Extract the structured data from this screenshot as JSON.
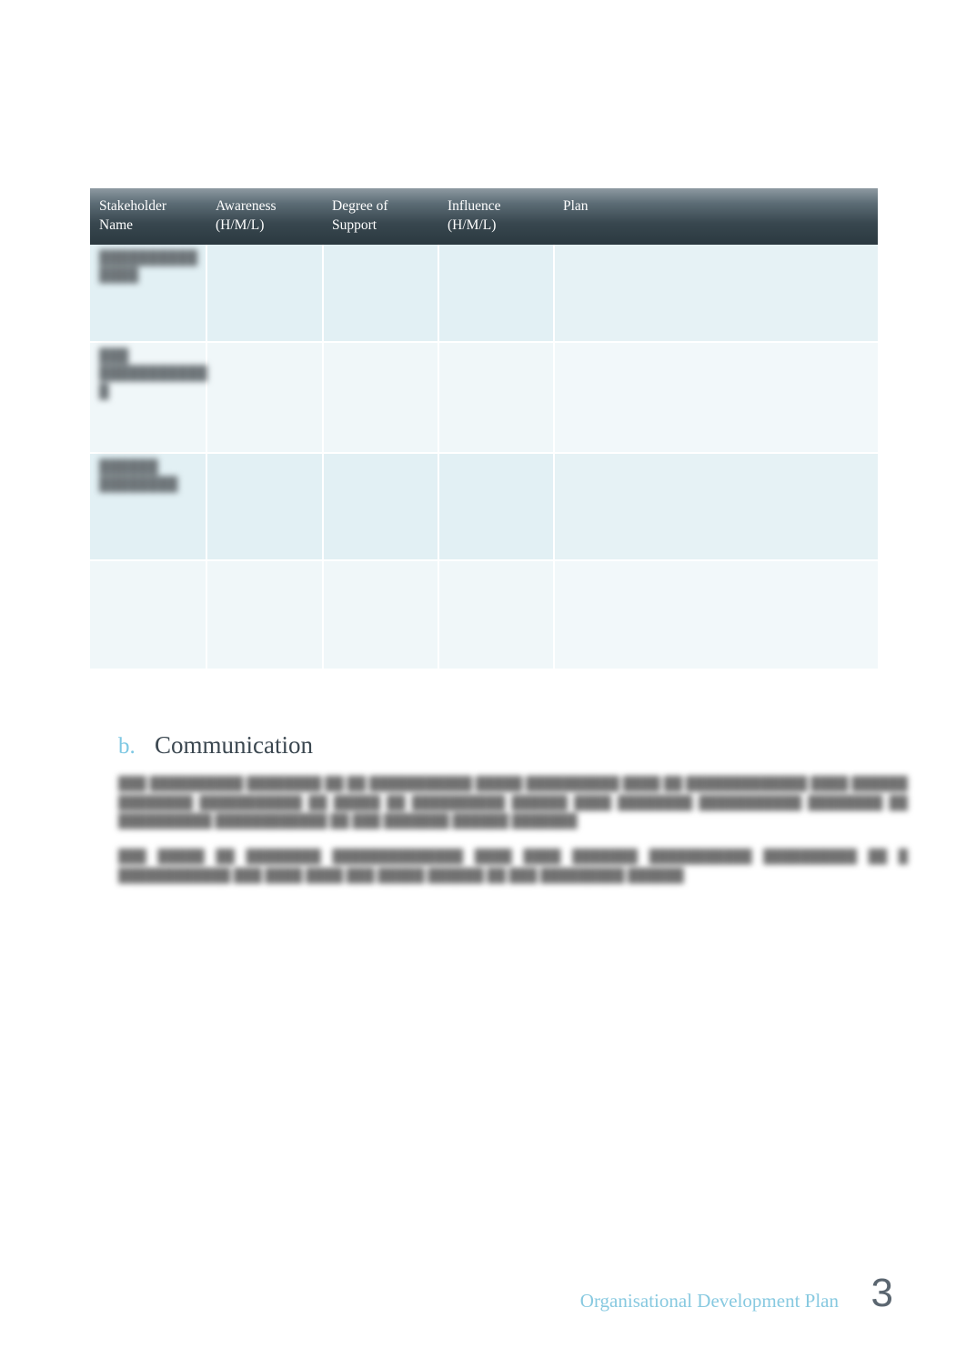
{
  "document": {
    "footer_title": "Organisational Development Plan",
    "page_number": "3"
  },
  "colors": {
    "accent_blue": "#7ec8e3",
    "footer_blue": "#87c9e0",
    "header_dark": "#2b3940",
    "header_light": "#8e9aa2",
    "row_band_a": "#e2f0f4",
    "row_band_b": "#f0f7f9",
    "heading_text": "#3b4750",
    "page_number_grey": "#5b6670"
  },
  "stakeholder_table": {
    "columns": [
      "Stakeholder Name",
      "Awareness (H/M/L)",
      "Degree of Support",
      "Influence (H/M/L)",
      "Plan"
    ],
    "rows": [
      {
        "name": "██████████\n████",
        "awareness": "",
        "degree_of_support": "",
        "influence": "",
        "plan": ""
      },
      {
        "name": "███\n███████████\n█",
        "awareness": "",
        "degree_of_support": "",
        "influence": "",
        "plan": ""
      },
      {
        "name": "██████\n████████",
        "awareness": "",
        "degree_of_support": "",
        "influence": "",
        "plan": ""
      },
      {
        "name": "",
        "awareness": "",
        "degree_of_support": "",
        "influence": "",
        "plan": ""
      }
    ]
  },
  "section": {
    "marker": "b.",
    "title": "Communication",
    "paragraphs": [
      "███ ██████████ ████████ ██ ██ ███████████ █████ ██████████ ████ ██ █████████████ ████ ██████ ████████ ███████████ ██ █████ ██ ██████████ ██████ ████ ████████ ███████████ ████████ ██ ██████████ ████████████ ██ ███ ███████ ██████ ███████",
      "███ █████ ██ ████████ ██████████████ ████ ████ ███████ ███████████ ██████████ ██ █ ████████████ ███ ████ ████ ███ █████ ██████ ██ ███ █████████ ██████"
    ]
  }
}
